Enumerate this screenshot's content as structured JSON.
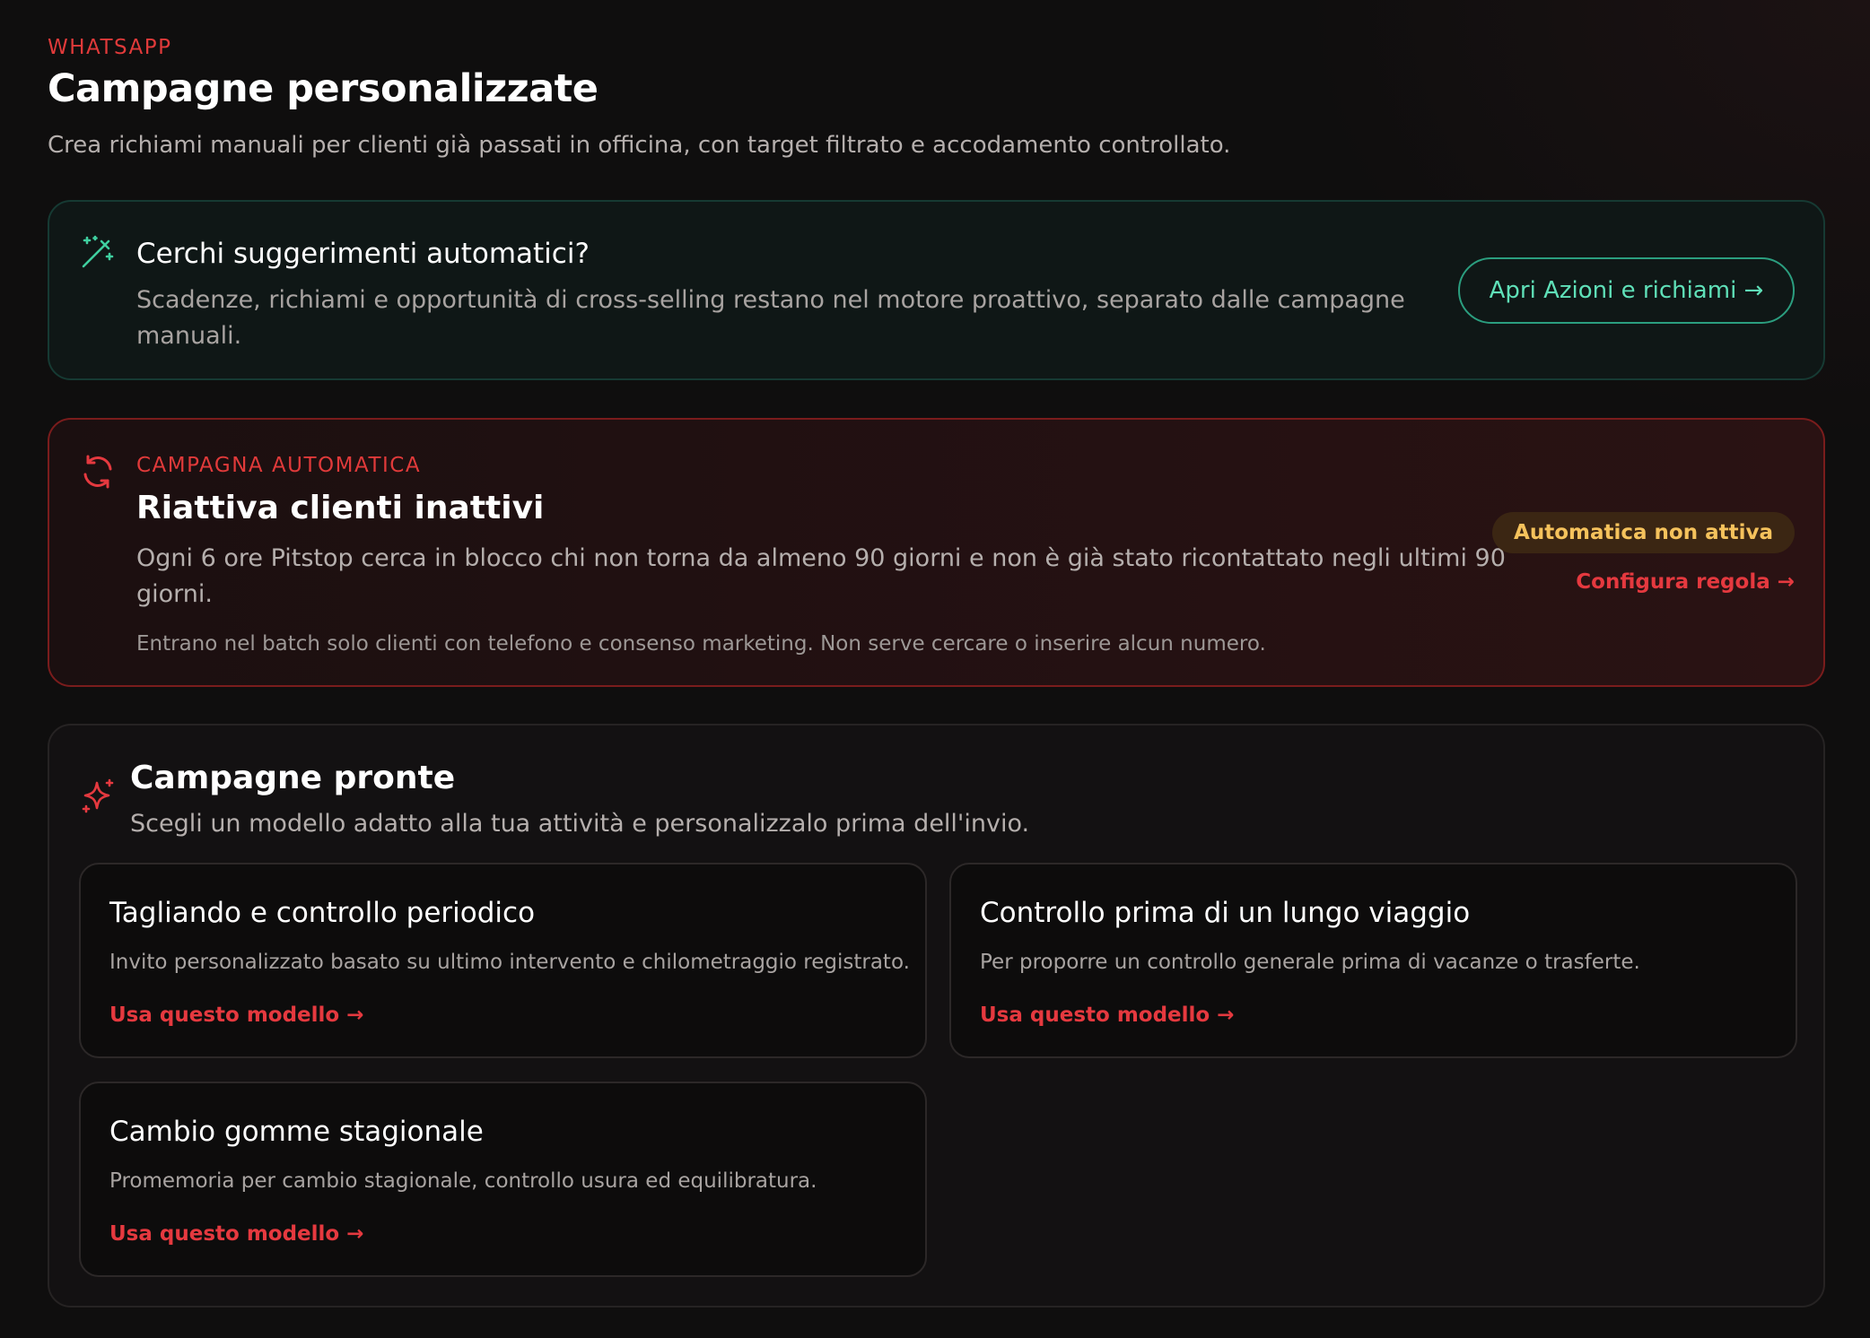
{
  "header": {
    "eyebrow": "WHATSAPP",
    "title": "Campagne personalizzate",
    "subtitle": "Crea richiami manuali per clienti già passati in officina, con target filtrato e accodamento controllato."
  },
  "suggestion": {
    "icon": "magic-wand-icon",
    "title": "Cerchi suggerimenti automatici?",
    "description": "Scadenze, richiami e opportunità di cross-selling restano nel motore proattivo, separato dalle campagne manuali.",
    "button_label": "Apri Azioni e richiami →"
  },
  "automatic_campaign": {
    "icon": "refresh-icon",
    "eyebrow": "CAMPAGNA AUTOMATICA",
    "title": "Riattiva clienti inattivi",
    "description": "Ogni 6 ore Pitstop cerca in blocco chi non torna da almeno 90 giorni e non è già stato ricontattato negli ultimi 90 giorni.",
    "note": "Entrano nel batch solo clienti con telefono e consenso marketing. Non serve cercare o inserire alcun numero.",
    "status_badge": "Automatica non attiva",
    "config_link": "Configura regola →"
  },
  "templates": {
    "icon": "sparkle-icon",
    "title": "Campagne pronte",
    "subtitle": "Scegli un modello adatto alla tua attività e personalizzalo prima dell'invio.",
    "items": [
      {
        "title": "Tagliando e controllo periodico",
        "description": "Invito personalizzato basato su ultimo intervento e chilometraggio registrato.",
        "link": "Usa questo modello →"
      },
      {
        "title": "Controllo prima di un lungo viaggio",
        "description": "Per proporre un controllo generale prima di vacanze o trasferte.",
        "link": "Usa questo modello →"
      },
      {
        "title": "Cambio gomme stagionale",
        "description": "Promemoria per cambio stagionale, controllo usura ed equilibratura.",
        "link": "Usa questo modello →"
      }
    ]
  },
  "colors": {
    "accent_red": "#e03a3a",
    "accent_green": "#5fe0b8",
    "badge_amber": "#f5c25c",
    "background": "#0f0e0e"
  }
}
